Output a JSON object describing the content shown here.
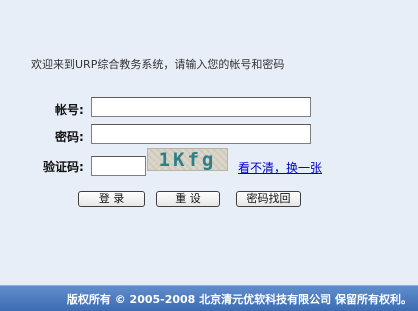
{
  "welcome_text": "欢迎来到URP综合教务系统，请输入您的帐号和密码",
  "form": {
    "account_label": "帐号:",
    "account_value": "",
    "password_label": "密码:",
    "password_value": "",
    "captcha_label": "验证码:",
    "captcha_value": "",
    "captcha_image_text": "1Kfg",
    "refresh_link_label": "看不清，换一张"
  },
  "buttons": {
    "login_label": "登 录",
    "reset_label": "重 设",
    "recover_label": "密码找回"
  },
  "footer": {
    "copyright": "版权所有 © 2005-2008 北京清元优软科技有限公司 保留所有权利。"
  },
  "colors": {
    "background": "#e8eef8",
    "link": "#0000cc",
    "footer_bar": "#4a78bd",
    "captcha_text": "#2f7f88"
  }
}
